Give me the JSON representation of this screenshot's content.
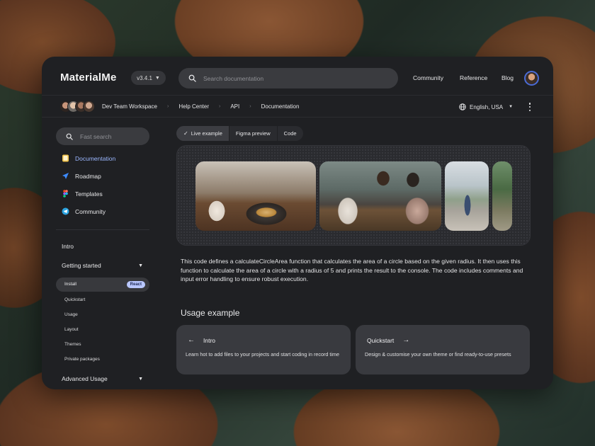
{
  "app": {
    "logo": "MaterialMe",
    "version": "v3.4.1"
  },
  "topbar": {
    "search_placeholder": "Search documentation",
    "nav": [
      "Community",
      "Reference",
      "Blog"
    ]
  },
  "breadcrumb": {
    "items": [
      "Dev Team Workspace",
      "Help Center",
      "API",
      "Documentation"
    ],
    "language": "English, USA"
  },
  "sidebar": {
    "search_placeholder": "Fast search",
    "items": [
      {
        "label": "Documentation",
        "icon": "doc-icon",
        "active": true
      },
      {
        "label": "Roadmap",
        "icon": "send-icon",
        "active": false
      },
      {
        "label": "Templates",
        "icon": "figma-icon",
        "active": false
      },
      {
        "label": "Community",
        "icon": "telegram-icon",
        "active": false
      }
    ],
    "intro": "Intro",
    "getting_started": "Getting started",
    "sub_items": [
      "Install",
      "Quickstart",
      "Usage",
      "Layout",
      "Themes",
      "Private packages"
    ],
    "install_badge": "React",
    "advanced": "Advanced Usage"
  },
  "main": {
    "tabs": [
      "Live example",
      "Figma preview",
      "Code"
    ],
    "description": "This code defines a calculateCircleArea function that calculates the area of a circle based on the given radius. It then uses this function to calculate the area of a circle with a radius of 5 and prints the result to the console. The code includes comments and input error handling to ensure robust execution.",
    "usage_title": "Usage example",
    "cards": [
      {
        "title": "Intro",
        "body": "Learn hot to add files to your projects and start coding in record time"
      },
      {
        "title": "Quickstart",
        "body": "Design & customise your own theme or find ready-to-use presets"
      }
    ]
  },
  "colors": {
    "accent": "#9bb7ff",
    "badge": "#b9c7ff",
    "window_bg": "#1f2023"
  }
}
